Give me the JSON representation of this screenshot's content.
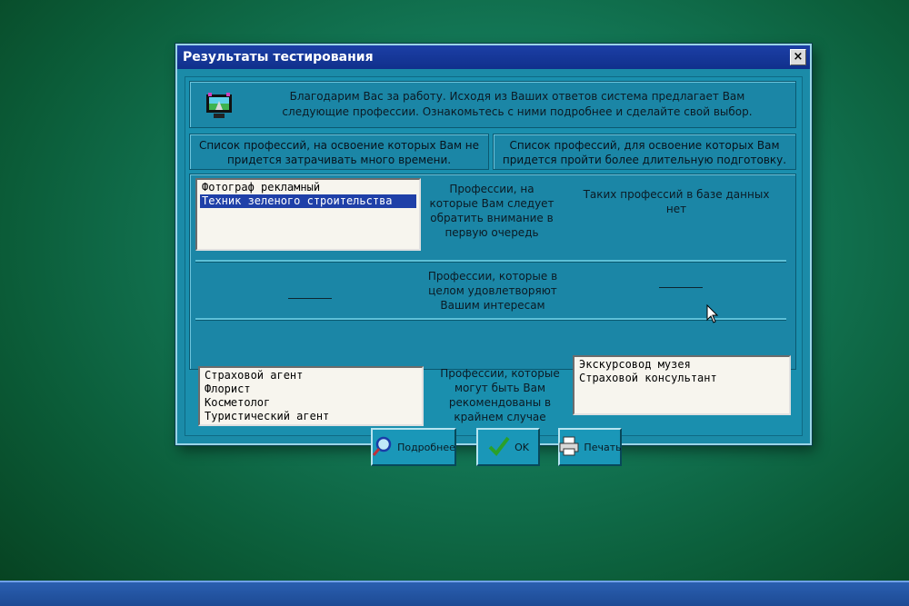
{
  "window": {
    "title": "Результаты тестирования",
    "close_label": "×"
  },
  "intro": {
    "text": "Благодарим Вас за работу. Исходя из Ваших ответов система предлагает Вам следующие профессии. Ознакомьтесь с ними подробнее и сделайте свой выбор."
  },
  "headers": {
    "left": "Список профессий, на освоение которых Вам не придется затрачивать много времени.",
    "right": "Список профессий, для освоение которых Вам придется пройти более длительную подготовку."
  },
  "rows": {
    "first": {
      "label": "Профессии, на которые Вам следует обратить внимание в первую очередь",
      "left_items": [
        "Фотограф рекламный",
        "Техник зеленого строительства"
      ],
      "left_selected_index": 1,
      "right_text": "Таких профессий в базе данных нет"
    },
    "second": {
      "label": "Профессии, которые в целом удовлетворяют Вашим интересам",
      "left_placeholder": "______",
      "right_placeholder": "______"
    },
    "third": {
      "label": "Профессии, которые могут быть Вам рекомендованы в крайнем случае",
      "left_items": [
        "Страховой агент",
        "Флорист",
        "Косметолог",
        "Туристический агент"
      ],
      "right_items": [
        "Экскурсовод музея",
        "Страховой консультант"
      ]
    }
  },
  "buttons": {
    "details": {
      "label": "Подробнее",
      "icon": "magnifier-icon"
    },
    "ok": {
      "label": "OK",
      "icon": "checkmark-icon"
    },
    "print": {
      "label": "Печать",
      "icon": "printer-icon"
    }
  },
  "colors": {
    "titlebar": "#10308c",
    "window_bg": "#1b8ba8",
    "selection": "#1f40a8"
  }
}
